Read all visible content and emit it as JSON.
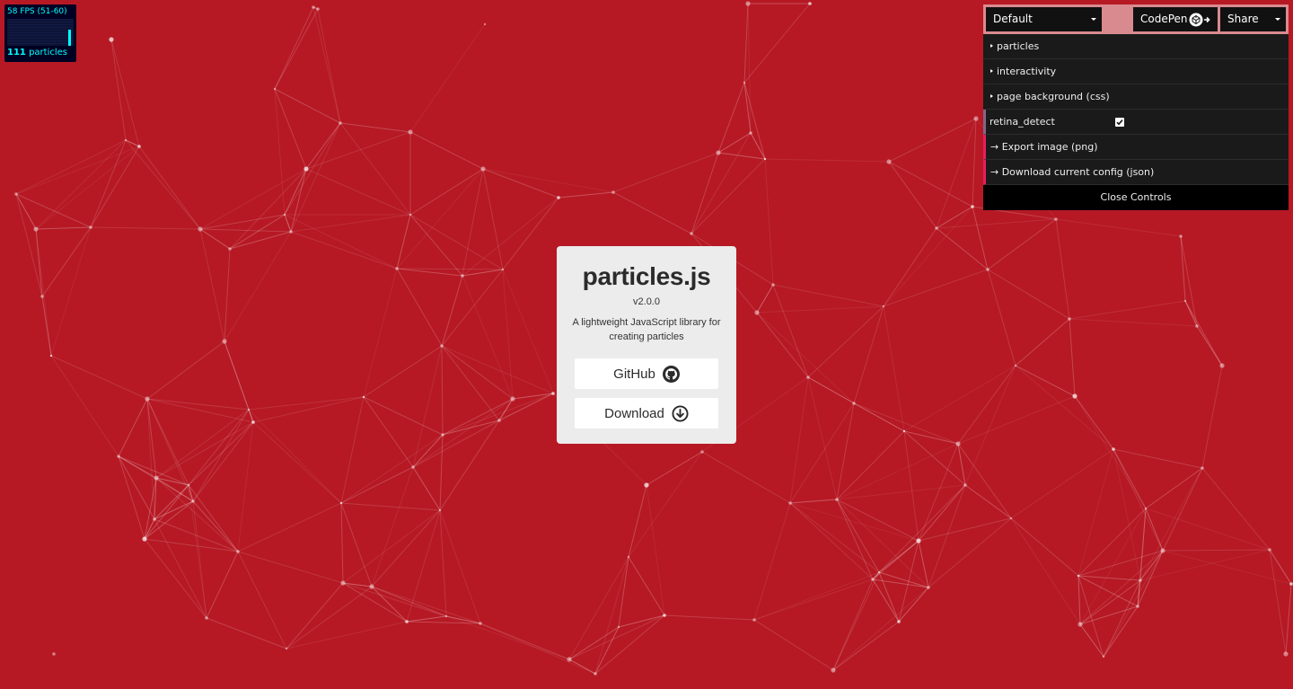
{
  "colors": {
    "background": "#b61924",
    "particle": "#ffffff",
    "card_bg": "#ececec",
    "stats_accent": "#00ffff",
    "panel_bg": "#1a1a1a"
  },
  "stats": {
    "fps_label": "58 FPS (51-60)",
    "particles_number": "111",
    "particles_label": "particles"
  },
  "card": {
    "title": "particles.js",
    "version": "v2.0.0",
    "description": "A lightweight JavaScript library for creating particles",
    "github_label": "GitHub",
    "github_icon": "github-icon",
    "download_label": "Download",
    "download_icon": "download-circle-icon"
  },
  "controls": {
    "preset_value": "Default",
    "codepen_label": "CodePen",
    "share_label": "Share",
    "folders": [
      "particles",
      "interactivity",
      "page background (css)"
    ],
    "retina_detect_label": "retina_detect",
    "retina_detect_checked": true,
    "export_image_label": "→ Export image (png)",
    "download_config_label": "→ Download current config (json)",
    "close_label": "Close Controls"
  }
}
